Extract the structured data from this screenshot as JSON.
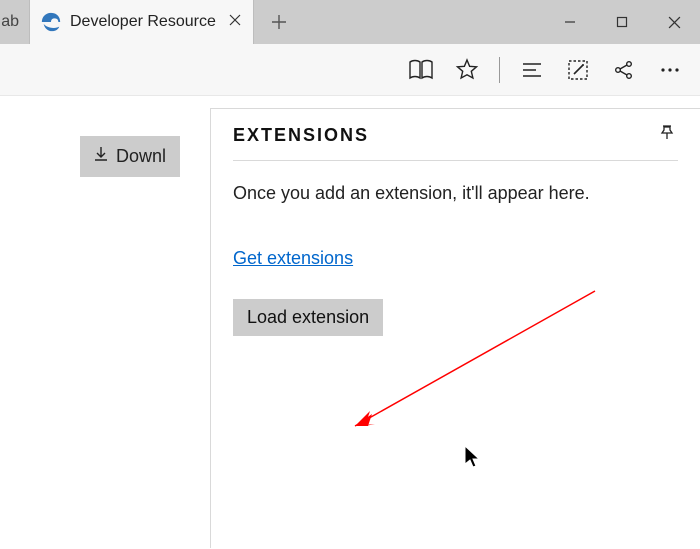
{
  "window": {
    "prev_tab_fragment": "ab",
    "active_tab_title": "Developer Resource"
  },
  "page": {
    "download_button": "Downl"
  },
  "panel": {
    "title": "EXTENSIONS",
    "hint": "Once you add an extension, it'll appear here.",
    "get_link": "Get extensions",
    "load_button": "Load extension"
  }
}
